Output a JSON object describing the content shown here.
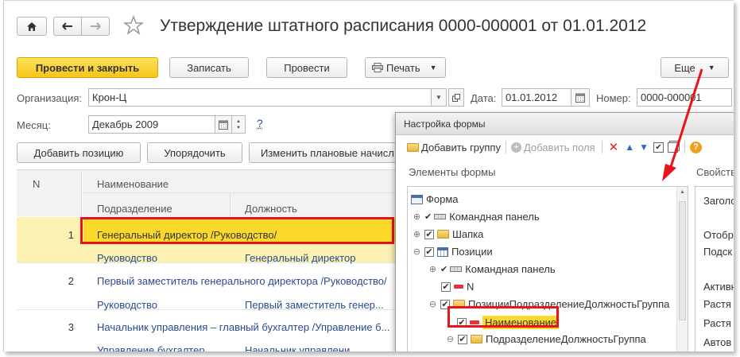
{
  "header": {
    "title": "Утверждение штатного расписания 0000-000001 от 01.01.2012"
  },
  "toolbar": {
    "post_close": "Провести и закрыть",
    "save": "Записать",
    "post": "Провести",
    "print": "Печать",
    "more": "Еще"
  },
  "fields": {
    "org_label": "Организация:",
    "org_value": "Крон-Ц",
    "date_label": "Дата:",
    "date_value": "01.01.2012",
    "number_label": "Номер:",
    "number_value": "0000-000001",
    "month_label": "Месяц:",
    "month_value": "Декабрь 2009",
    "help": "?"
  },
  "table_actions": {
    "add_position": "Добавить позицию",
    "sort": "Упорядочить",
    "change_planned": "Изменить плановые начисл"
  },
  "grid": {
    "col_n": "N",
    "col_name": "Наименование",
    "col_department": "Подразделение",
    "col_position": "Должность",
    "rows": [
      {
        "n": "1",
        "name": "Генеральный директор /Руководство/",
        "department": "Руководство",
        "position": "Генеральный директор"
      },
      {
        "n": "2",
        "name": "Первый заместитель генерального директора /Руководство/",
        "department": "Руководство",
        "position": "Первый заместитель генер..."
      },
      {
        "n": "3",
        "name": "Начальник управления – главный бухгалтер /Управление б...",
        "department": "Управление бухгалтер",
        "position": "Начальник управлени..."
      }
    ]
  },
  "settings": {
    "window_title": "Настройка формы",
    "add_group": "Добавить группу",
    "add_fields": "Добавить поля",
    "elements_label": "Элементы формы",
    "properties_label": "Свойства",
    "tree": [
      {
        "label": "Форма"
      },
      {
        "label": "Командная панель"
      },
      {
        "label": "Шапка"
      },
      {
        "label": "Позиции"
      },
      {
        "label": "Командная панель"
      },
      {
        "label": "N"
      },
      {
        "label": "ПозицииПодразделениеДолжностьГруппа"
      },
      {
        "label": "Наименование"
      },
      {
        "label": "ПодразделениеДолжностьГруппа"
      }
    ],
    "props": [
      "Заголо",
      "Отобр",
      "Подск",
      "Активн",
      "Растя",
      "Растя",
      "Автов"
    ]
  },
  "colors": {
    "accent_yellow": "#f5c51a",
    "highlight_row": "#fbf1b3",
    "selected_row": "#fbd92b",
    "callout_red": "#e8141b",
    "link_blue": "#2a4b8d"
  }
}
